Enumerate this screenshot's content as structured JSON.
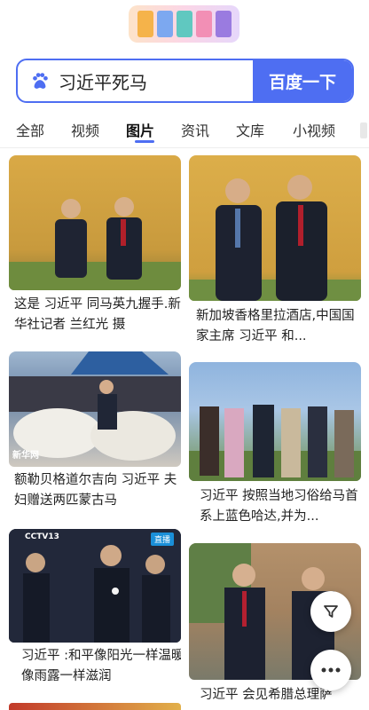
{
  "search": {
    "query": "习近平死马",
    "button_label": "百度一下"
  },
  "tabs": [
    "全部",
    "视频",
    "图片",
    "资讯",
    "文库",
    "小视频"
  ],
  "active_tab": "图片",
  "results": [
    {
      "caption": "这是 习近平 同马英九握手.新华社记者 兰红光 摄"
    },
    {
      "caption": "新加坡香格里拉酒店,中国国家主席 习近平 和..."
    },
    {
      "caption": "额勒贝格道尔吉向 习近平 夫妇赠送两匹蒙古马",
      "watermark": "新华网"
    },
    {
      "caption": "习近平 按照当地习俗给马首系上蓝色哈达,并为..."
    },
    {
      "caption": "习近平 :和平像阳光一样温暖,像雨露一样滋润",
      "channel_badge": "CCTV13",
      "live_badge": "直播"
    },
    {
      "caption": "习近平 会见希腊总理萨"
    }
  ],
  "colors": {
    "accent": "#4e6ef2"
  },
  "icons": {
    "filter": "filter-icon",
    "more": "more-icon",
    "logo": "paw-icon"
  }
}
